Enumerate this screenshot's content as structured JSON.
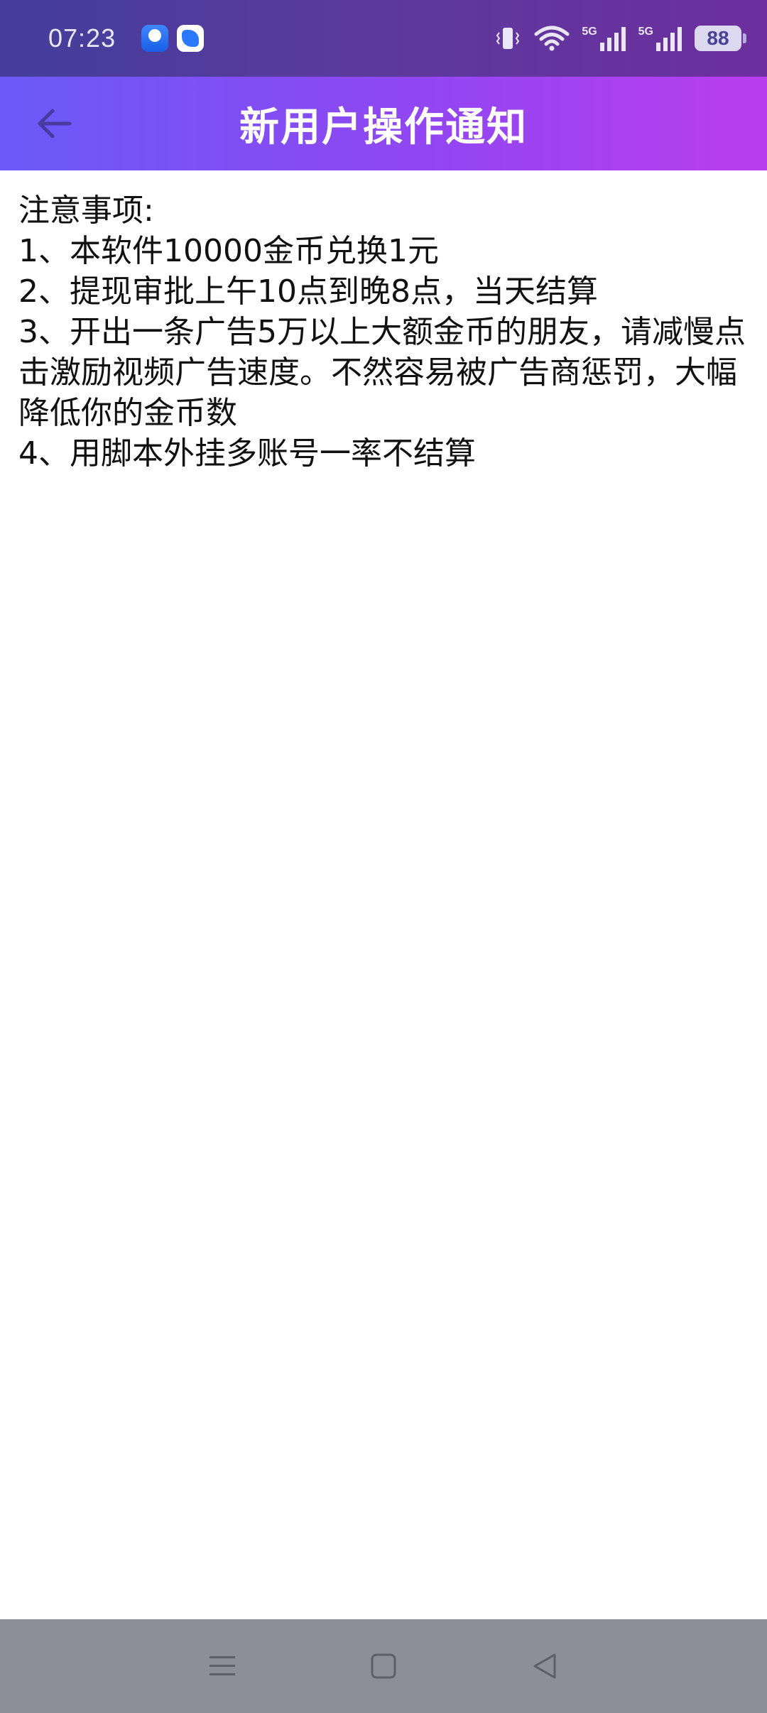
{
  "status_bar": {
    "time": "07:23",
    "network_1": "5G",
    "network_2": "5G",
    "battery": "88",
    "icons": [
      "app-icon-1",
      "app-icon-2",
      "vibrate-icon",
      "wifi-icon",
      "signal-icon",
      "signal-icon",
      "battery-icon"
    ]
  },
  "header": {
    "title": "新用户操作通知",
    "back_icon": "arrow-left-icon"
  },
  "content": {
    "lines": [
      "注意事项:",
      "1、本软件10000金币兑换1元",
      "2、提现审批上午10点到晚8点，当天结算",
      "3、开出一条广告5万以上大额金币的朋友，请减慢点击激励视频广告速度。不然容易被广告商惩罚，大幅降低你的金币数",
      "4、用脚本外挂多账号一率不结算"
    ]
  },
  "nav_bar": {
    "buttons": [
      "menu-icon",
      "home-icon",
      "back-triangle-icon"
    ]
  },
  "colors": {
    "status_bar": "#4a3b9b",
    "header_start": "#6a5af9",
    "header_end": "#ba3df0",
    "nav_bar": "#8c8e98",
    "text": "#111111"
  }
}
